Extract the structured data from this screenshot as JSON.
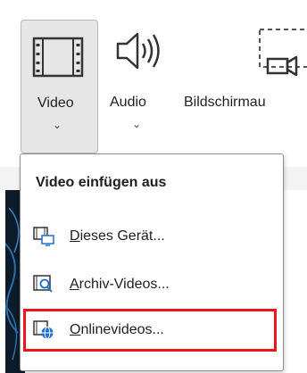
{
  "ribbon": {
    "video": {
      "label": "Video",
      "chevron": "⌄",
      "icon": "film-icon"
    },
    "audio": {
      "label": "Audio",
      "chevron": "⌄",
      "icon": "speaker-icon"
    },
    "screen": {
      "label": "Bildschirmau",
      "icon": "screen-recording-icon"
    }
  },
  "dropdown": {
    "title": "Video einfügen aus",
    "items": [
      {
        "label": "Dieses Gerät...",
        "icon": "device-video-icon"
      },
      {
        "label": "Archiv-Videos...",
        "icon": "stock-video-icon"
      },
      {
        "label": "Onlinevideos...",
        "icon": "online-video-icon",
        "highlighted": true
      }
    ]
  },
  "colors": {
    "highlight": "#e8191d",
    "accent_blue": "#1e6fd0",
    "selected_bg": "#e6e6e6"
  }
}
